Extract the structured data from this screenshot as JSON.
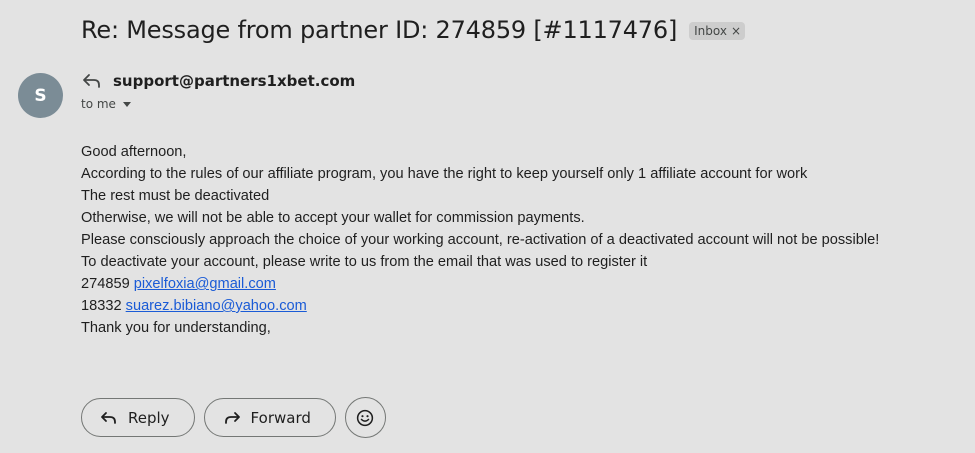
{
  "email": {
    "subject": "Re: Message from partner ID: 274859 [#1117476]",
    "label_chip": "Inbox",
    "label_chip_close": "×",
    "avatar_letter": "S",
    "sender": "support@partners1xbet.com",
    "recipient": "to me",
    "body_lines": [
      "Good afternoon,",
      "According to the rules of our affiliate program, you have the right to keep yourself only 1 affiliate account for work",
      "The rest must be deactivated",
      "Otherwise, we will not be able to accept your wallet for commission payments.",
      "Please consciously approach the choice of your working account, re-activation of a deactivated account will not be possible!",
      "To deactivate your account, please write to us from the email that was used to register it"
    ],
    "accounts": [
      {
        "id": "274859",
        "email": "pixelfoxia@gmail.com"
      },
      {
        "id": "18332",
        "email": "suarez.bibiano@yahoo.com"
      }
    ],
    "closing": "Thank you for understanding,"
  },
  "actions": {
    "reply_label": "Reply",
    "forward_label": "Forward"
  },
  "icons": {
    "reply": "reply-arrow-icon",
    "forward": "forward-arrow-icon",
    "emoji": "emoji-smile-icon",
    "caret": "caret-down-icon"
  },
  "colors": {
    "background": "#e3e3e3",
    "avatar": "#7b8c96",
    "link": "#1a5bd6",
    "chip": "#cdcdcd"
  }
}
